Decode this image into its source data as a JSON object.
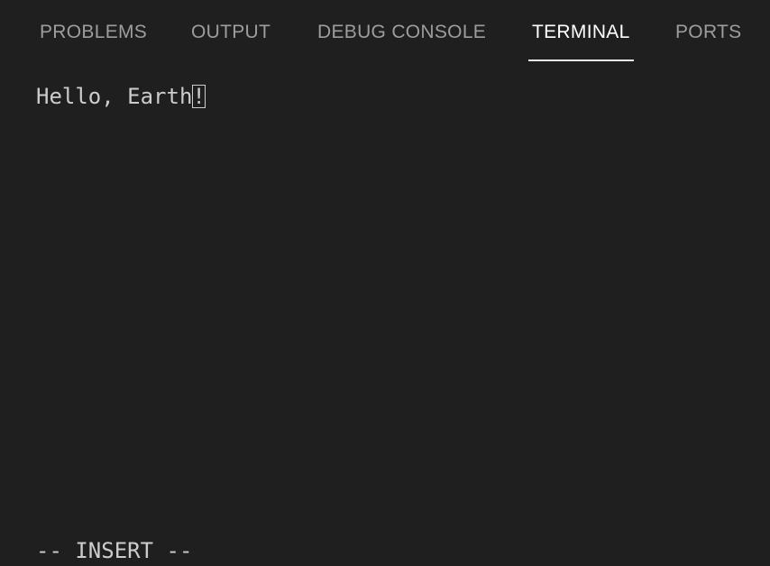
{
  "tabs": [
    {
      "label": "PROBLEMS",
      "active": false
    },
    {
      "label": "OUTPUT",
      "active": false
    },
    {
      "label": "DEBUG CONSOLE",
      "active": false
    },
    {
      "label": "TERMINAL",
      "active": true
    },
    {
      "label": "PORTS",
      "active": false
    }
  ],
  "terminal": {
    "text_before_cursor": "Hello, Earth",
    "cursor_char": "!",
    "mode_line": "-- INSERT --"
  },
  "colors": {
    "background": "#1f1f1f",
    "tab_inactive": "#9d9d9d",
    "tab_active": "#ffffff",
    "terminal_text": "#cccccc"
  }
}
